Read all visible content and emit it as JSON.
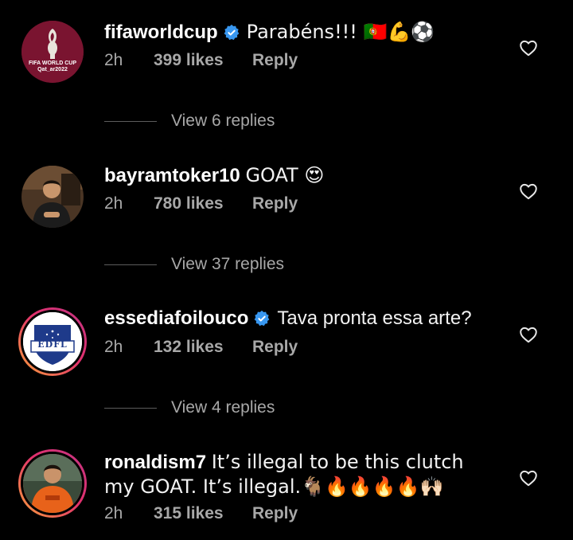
{
  "comments": [
    {
      "username": "fifaworldcup",
      "verified": true,
      "text": "Parabéns!!! 🇵🇹💪⚽",
      "time": "2h",
      "likes": "399 likes",
      "reply": "Reply",
      "view_replies": "View 6 replies",
      "avatar_text": "FIFA WORLD CUP Qat_ar2022"
    },
    {
      "username": "bayramtoker10",
      "verified": false,
      "text": "GOAT 😍",
      "time": "2h",
      "likes": "780 likes",
      "reply": "Reply",
      "view_replies": "View 37 replies"
    },
    {
      "username": "essediafoilouco",
      "verified": true,
      "text": "Tava pronta essa arte?",
      "time": "2h",
      "likes": "132 likes",
      "reply": "Reply",
      "view_replies": "View 4 replies",
      "avatar_text": "EDFL"
    },
    {
      "username": "ronaldism7",
      "verified": false,
      "text": "It’s illegal to be this clutch my GOAT. It’s  illegal.🐐🔥🔥🔥🔥🙌🏻",
      "time": "2h",
      "likes": "315 likes",
      "reply": "Reply"
    }
  ],
  "colors": {
    "background": "#000000",
    "text": "#f2f2f2",
    "secondary": "#a8a8a8",
    "verified": "#3897f0",
    "fifa": "#7a1430"
  }
}
